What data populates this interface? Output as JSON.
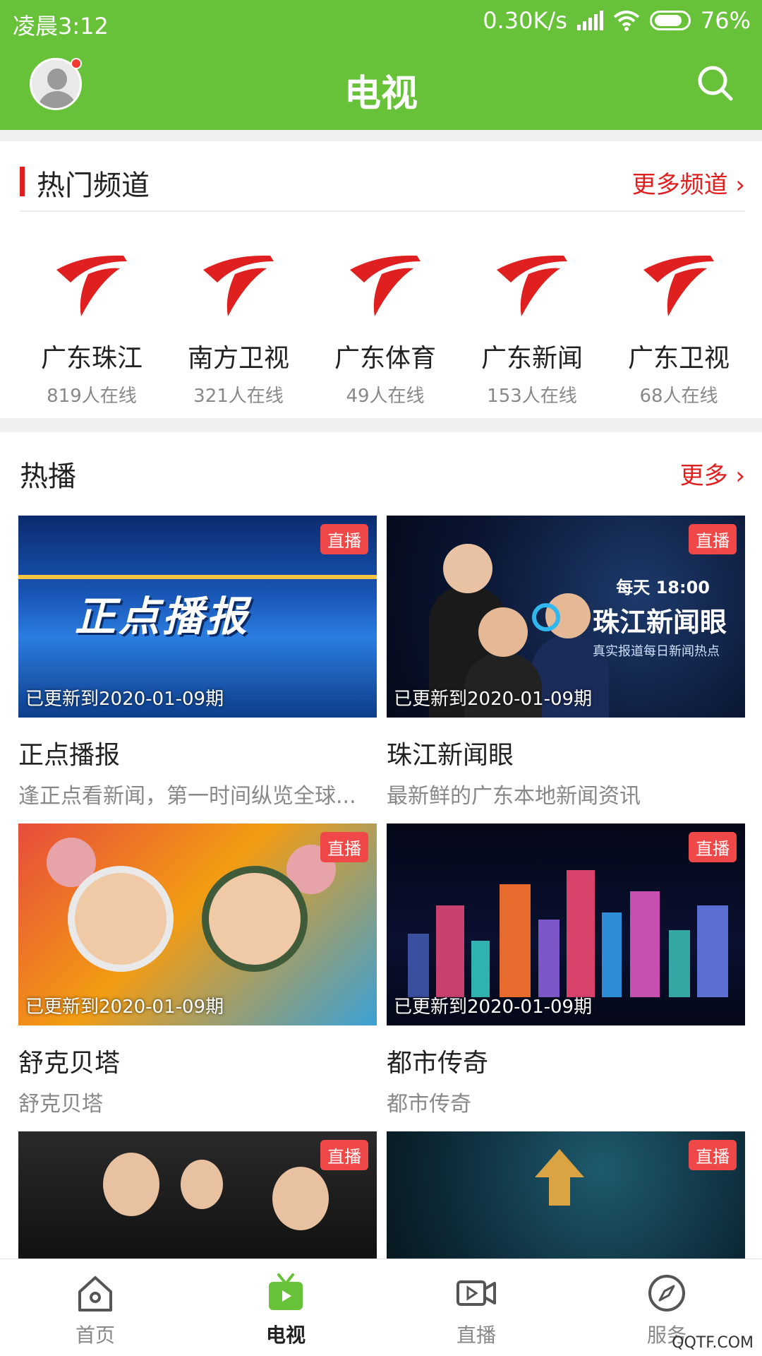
{
  "status": {
    "time": "凌晨3:12",
    "speed": "0.30K/s",
    "battery": "76%"
  },
  "header": {
    "title": "电视"
  },
  "channels_section": {
    "title": "热门频道",
    "more": "更多频道 ›",
    "items": [
      {
        "name": "广东珠江",
        "online": "819人在线"
      },
      {
        "name": "南方卫视",
        "online": "321人在线"
      },
      {
        "name": "广东体育",
        "online": "49人在线"
      },
      {
        "name": "广东新闻",
        "online": "153人在线"
      },
      {
        "name": "广东卫视",
        "online": "68人在线"
      }
    ]
  },
  "hot_section": {
    "title": "热播",
    "more": "更多 ›",
    "live_label": "直播",
    "items": [
      {
        "title": "正点播报",
        "desc": "逢正点看新闻，第一时间纵览全球...",
        "update": "已更新到2020-01-09期",
        "thumb_text": "正点播报"
      },
      {
        "title": "珠江新闻眼",
        "desc": "最新鲜的广东本地新闻资讯",
        "update": "已更新到2020-01-09期",
        "thumb_when": "每天 18:00",
        "thumb_text": "珠江新闻眼",
        "thumb_sub": "真实报道每日新闻热点"
      },
      {
        "title": "舒克贝塔",
        "desc": "舒克贝塔",
        "update": "已更新到2020-01-09期"
      },
      {
        "title": "都市传奇",
        "desc": "都市传奇",
        "update": "已更新到2020-01-09期"
      },
      {
        "title": "",
        "desc": "",
        "update": ""
      },
      {
        "title": "",
        "desc": "",
        "update": ""
      }
    ]
  },
  "bottom_nav": [
    {
      "label": "首页",
      "icon": "home-icon"
    },
    {
      "label": "电视",
      "icon": "tv-icon",
      "active": true
    },
    {
      "label": "直播",
      "icon": "video-camera-icon"
    },
    {
      "label": "服务",
      "icon": "compass-icon"
    }
  ],
  "watermark": "QQTF.COM",
  "colors": {
    "primary_green": "#67c23a",
    "accent_red": "#e02020",
    "badge_red": "#f04848"
  }
}
